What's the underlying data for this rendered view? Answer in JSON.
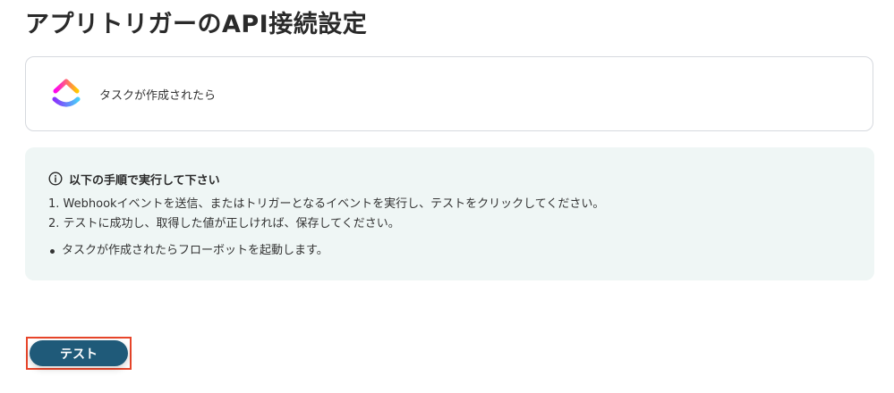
{
  "page": {
    "title": "アプリトリガーのAPI接続設定"
  },
  "trigger": {
    "app_logo_icon": "clickup-logo-icon",
    "label": "タスクが作成されたら"
  },
  "instructions": {
    "icon": "info-icon",
    "heading": "以下の手順で実行して下さい",
    "steps": [
      "1. Webhookイベントを送信、またはトリガーとなるイベントを実行し、テストをクリックしてください。",
      "2. テストに成功し、取得した値が正しければ、保存してください。"
    ],
    "notes": [
      "タスクが作成されたらフローボットを起動します。"
    ]
  },
  "actions": {
    "test_label": "テスト"
  },
  "colors": {
    "button": "#1f5a79",
    "highlight": "#e8452a",
    "panel": "#eff6f5"
  }
}
